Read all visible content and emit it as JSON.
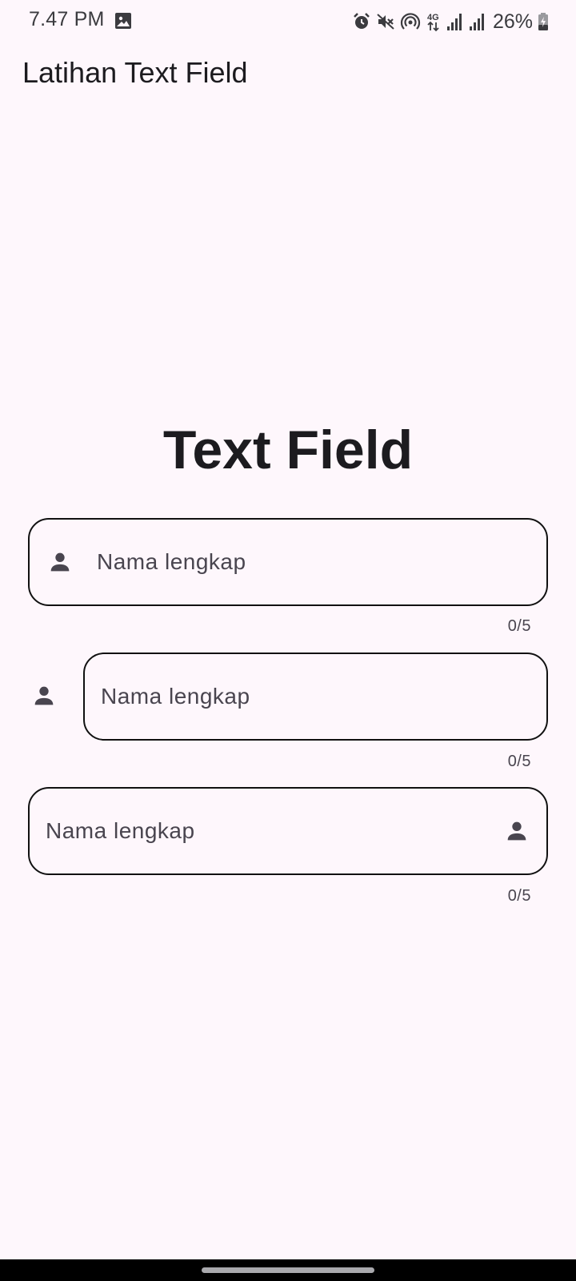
{
  "status_bar": {
    "time": "7.47 PM",
    "battery": "26%",
    "icons": [
      "gallery-icon",
      "alarm-icon",
      "mute-icon",
      "hotspot-icon",
      "4g-icon",
      "signal-icon",
      "signal-icon",
      "battery-charging-icon"
    ]
  },
  "app_bar": {
    "title": "Latihan Text Field"
  },
  "main": {
    "heading": "Text Field",
    "fields": [
      {
        "placeholder": "Nama lengkap",
        "counter": "0/5",
        "icon": "person-icon",
        "icon_position": "prefix-inside"
      },
      {
        "placeholder": "Nama lengkap",
        "counter": "0/5",
        "icon": "person-icon",
        "icon_position": "prefix-outside"
      },
      {
        "placeholder": "Nama lengkap",
        "counter": "0/5",
        "icon": "person-icon",
        "icon_position": "suffix-inside"
      }
    ]
  },
  "colors": {
    "background": "#fef7fc",
    "text": "#1c1b1f",
    "hint": "#49454f",
    "border": "#111111",
    "icon": "#49454f"
  }
}
